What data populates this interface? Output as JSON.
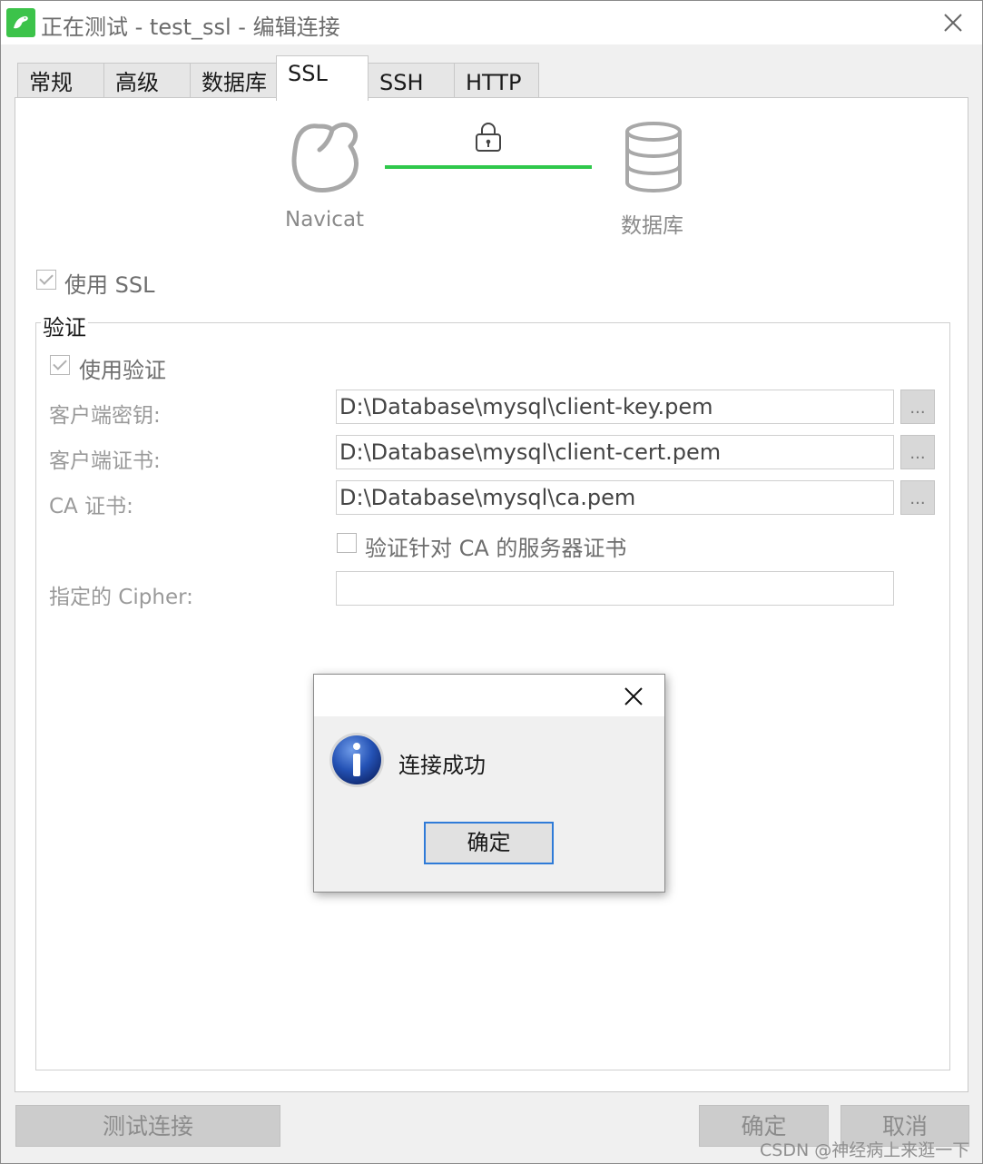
{
  "window": {
    "title": "正在测试 - test_ssl - 编辑连接"
  },
  "tabs": [
    {
      "label": "常规"
    },
    {
      "label": "高级"
    },
    {
      "label": "数据库"
    },
    {
      "label": "SSL"
    },
    {
      "label": "SSH"
    },
    {
      "label": "HTTP"
    }
  ],
  "diagram": {
    "left_label": "Navicat",
    "right_label": "数据库",
    "link_color": "#2fc84b"
  },
  "ssl": {
    "use_ssl_label": "使用 SSL",
    "group_title": "验证",
    "use_auth_label": "使用验证",
    "client_key_label": "客户端密钥:",
    "client_key_value": "D:\\Database\\mysql\\client-key.pem",
    "client_cert_label": "客户端证书:",
    "client_cert_value": "D:\\Database\\mysql\\client-cert.pem",
    "ca_label": "CA 证书:",
    "ca_value": "D:\\Database\\mysql\\ca.pem",
    "verify_server_label": "验证针对 CA 的服务器证书",
    "cipher_label": "指定的 Cipher:",
    "cipher_value": "",
    "browse_label": "..."
  },
  "dialog": {
    "message": "连接成功",
    "ok_label": "确定"
  },
  "footer": {
    "test_label": "测试连接",
    "ok_label": "确定",
    "cancel_label": "取消"
  },
  "watermark": "CSDN @神经病上来逛一下"
}
